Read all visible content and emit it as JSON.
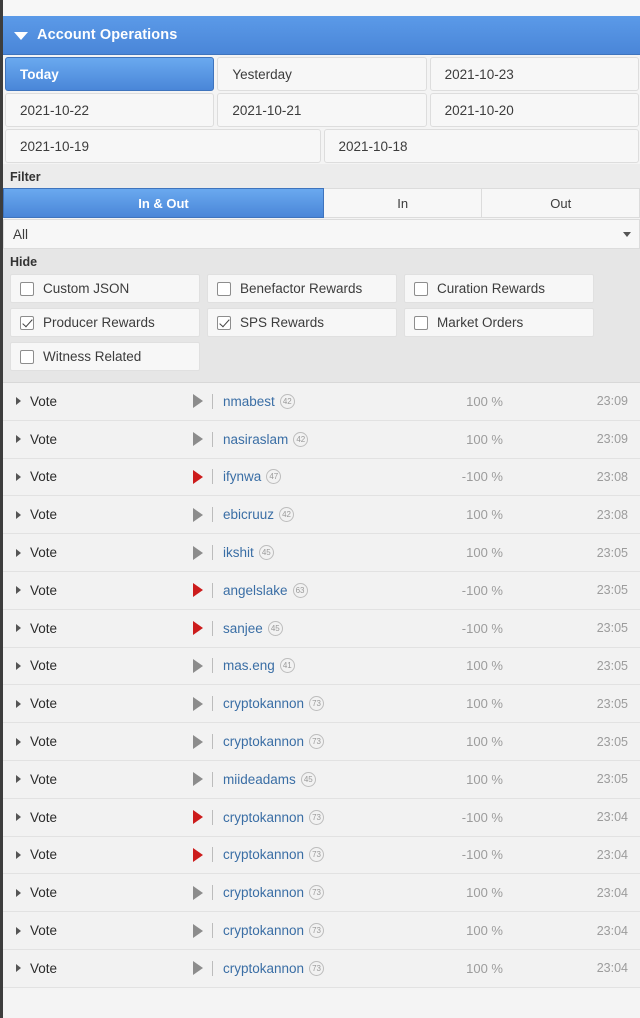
{
  "panel": {
    "title": "Account Operations",
    "caret_icon": "caret-down-icon"
  },
  "dates": {
    "rows": [
      [
        {
          "label": "Today",
          "active": true
        },
        {
          "label": "Yesterday",
          "active": false
        },
        {
          "label": "2021-10-23",
          "active": false
        }
      ],
      [
        {
          "label": "2021-10-22",
          "active": false
        },
        {
          "label": "2021-10-21",
          "active": false
        },
        {
          "label": "2021-10-20",
          "active": false
        }
      ],
      [
        {
          "label": "2021-10-19",
          "active": false
        },
        {
          "label": "2021-10-18",
          "active": false
        }
      ]
    ]
  },
  "filter": {
    "label": "Filter",
    "segments": [
      {
        "label": "In & Out",
        "active": true
      },
      {
        "label": "In",
        "active": false
      },
      {
        "label": "Out",
        "active": false
      }
    ],
    "select_value": "All",
    "select_caret_icon": "chevron-down-icon"
  },
  "hide": {
    "label": "Hide",
    "options": [
      {
        "label": "Custom JSON",
        "checked": false
      },
      {
        "label": "Benefactor Rewards",
        "checked": false
      },
      {
        "label": "Curation Rewards",
        "checked": false
      },
      {
        "label": "Producer Rewards",
        "checked": true
      },
      {
        "label": "SPS Rewards",
        "checked": true
      },
      {
        "label": "Market Orders",
        "checked": false
      },
      {
        "label": "Witness Related",
        "checked": false
      }
    ]
  },
  "colors": {
    "accent": "#4a86d8",
    "negative": "#cc1c1c",
    "positive": "#8c8c8c",
    "link": "#3a6ea5"
  },
  "transactions": [
    {
      "type": "Vote",
      "user": "nmabest",
      "rep": "42",
      "pct": "100 %",
      "time": "23:09",
      "negative": false
    },
    {
      "type": "Vote",
      "user": "nasiraslam",
      "rep": "42",
      "pct": "100 %",
      "time": "23:09",
      "negative": false
    },
    {
      "type": "Vote",
      "user": "ifynwa",
      "rep": "47",
      "pct": "-100 %",
      "time": "23:08",
      "negative": true
    },
    {
      "type": "Vote",
      "user": "ebicruuz",
      "rep": "42",
      "pct": "100 %",
      "time": "23:08",
      "negative": false
    },
    {
      "type": "Vote",
      "user": "ikshit",
      "rep": "45",
      "pct": "100 %",
      "time": "23:05",
      "negative": false
    },
    {
      "type": "Vote",
      "user": "angelslake",
      "rep": "63",
      "pct": "-100 %",
      "time": "23:05",
      "negative": true
    },
    {
      "type": "Vote",
      "user": "sanjee",
      "rep": "45",
      "pct": "-100 %",
      "time": "23:05",
      "negative": true
    },
    {
      "type": "Vote",
      "user": "mas.eng",
      "rep": "41",
      "pct": "100 %",
      "time": "23:05",
      "negative": false
    },
    {
      "type": "Vote",
      "user": "cryptokannon",
      "rep": "73",
      "pct": "100 %",
      "time": "23:05",
      "negative": false
    },
    {
      "type": "Vote",
      "user": "cryptokannon",
      "rep": "73",
      "pct": "100 %",
      "time": "23:05",
      "negative": false
    },
    {
      "type": "Vote",
      "user": "miideadams",
      "rep": "45",
      "pct": "100 %",
      "time": "23:05",
      "negative": false
    },
    {
      "type": "Vote",
      "user": "cryptokannon",
      "rep": "73",
      "pct": "-100 %",
      "time": "23:04",
      "negative": true
    },
    {
      "type": "Vote",
      "user": "cryptokannon",
      "rep": "73",
      "pct": "-100 %",
      "time": "23:04",
      "negative": true
    },
    {
      "type": "Vote",
      "user": "cryptokannon",
      "rep": "73",
      "pct": "100 %",
      "time": "23:04",
      "negative": false
    },
    {
      "type": "Vote",
      "user": "cryptokannon",
      "rep": "73",
      "pct": "100 %",
      "time": "23:04",
      "negative": false
    },
    {
      "type": "Vote",
      "user": "cryptokannon",
      "rep": "73",
      "pct": "100 %",
      "time": "23:04",
      "negative": false
    }
  ]
}
